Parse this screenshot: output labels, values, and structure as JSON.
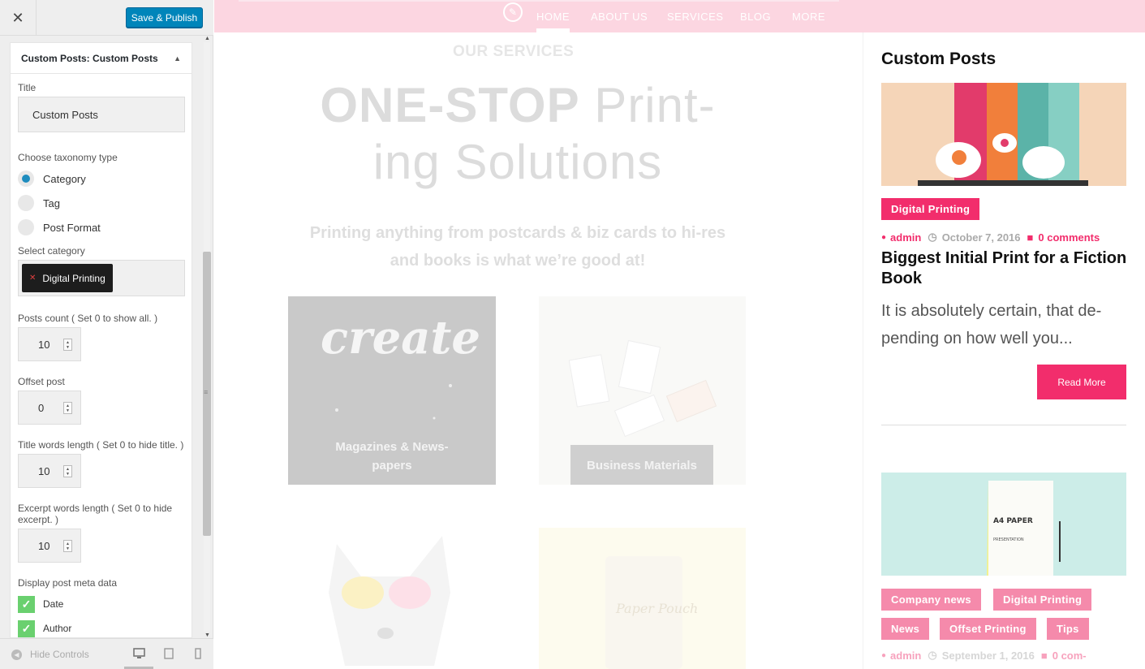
{
  "customizer": {
    "close_glyph": "✕",
    "save_label": "Save & Publish",
    "widget_header_prefix": "Custom Posts:",
    "widget_header_name": "Custom Posts",
    "title_label": "Title",
    "title_value": "Custom Posts",
    "taxonomy_label": "Choose taxonomy type",
    "taxonomy_options": [
      "Category",
      "Tag",
      "Post Format"
    ],
    "taxonomy_selected": "Category",
    "category_label": "Select category",
    "category_selected": "Digital Printing",
    "posts_count_label": "Posts count ( Set 0 to show all. )",
    "posts_count_value": "10",
    "offset_label": "Offset post",
    "offset_value": "0",
    "title_words_label": "Title words length ( Set 0 to hide title. )",
    "title_words_value": "10",
    "excerpt_words_label": "Excerpt words length ( Set 0 to hide excerpt. )",
    "excerpt_words_value": "10",
    "meta_label": "Display post meta data",
    "meta_options": [
      {
        "label": "Date",
        "checked": true
      },
      {
        "label": "Author",
        "checked": true
      }
    ],
    "hide_controls_label": "Hide Controls",
    "accent_color": "#0085ba"
  },
  "site": {
    "nav": [
      "HOME",
      "ABOUT US",
      "SERVICES",
      "BLOG",
      "MORE"
    ],
    "nav_active": "HOME",
    "services_kicker": "OUR SERVICES",
    "services_title_bold": "ONE-STOP",
    "services_title_rest_1": "Print-",
    "services_title_rest_2": "ing Solutions",
    "services_subtitle": "Printing anything from postcards & biz cards to hi-res and books is what we’re good at!",
    "tiles": [
      {
        "caption": "Magazines & News-papers",
        "art_text": "create YOUR"
      },
      {
        "caption": "Business Materials"
      },
      {
        "caption": ""
      },
      {
        "caption": "",
        "art_text": "Paper Pouch"
      }
    ],
    "sidebar": {
      "title": "Custom Posts",
      "posts": [
        {
          "categories": [
            "Digital Printing"
          ],
          "author": "admin",
          "date": "October 7, 2016",
          "comments": "0 comments",
          "title": "Biggest Initial Print for a Fiction Book",
          "excerpt": "It is absolutely certain, that de-pending on how well you...",
          "read_more": "Read More"
        },
        {
          "categories": [
            "Company news",
            "Digital Printing",
            "News",
            "Offset Printing",
            "Tips"
          ],
          "author": "admin",
          "date": "September 1, 2016",
          "comments": "0 com-",
          "image_text_1": "A4 PAPER",
          "image_text_2": "PRESENTATION"
        }
      ]
    },
    "brand_color": "#f22d6c",
    "nav_color": "#fcd6e1"
  }
}
